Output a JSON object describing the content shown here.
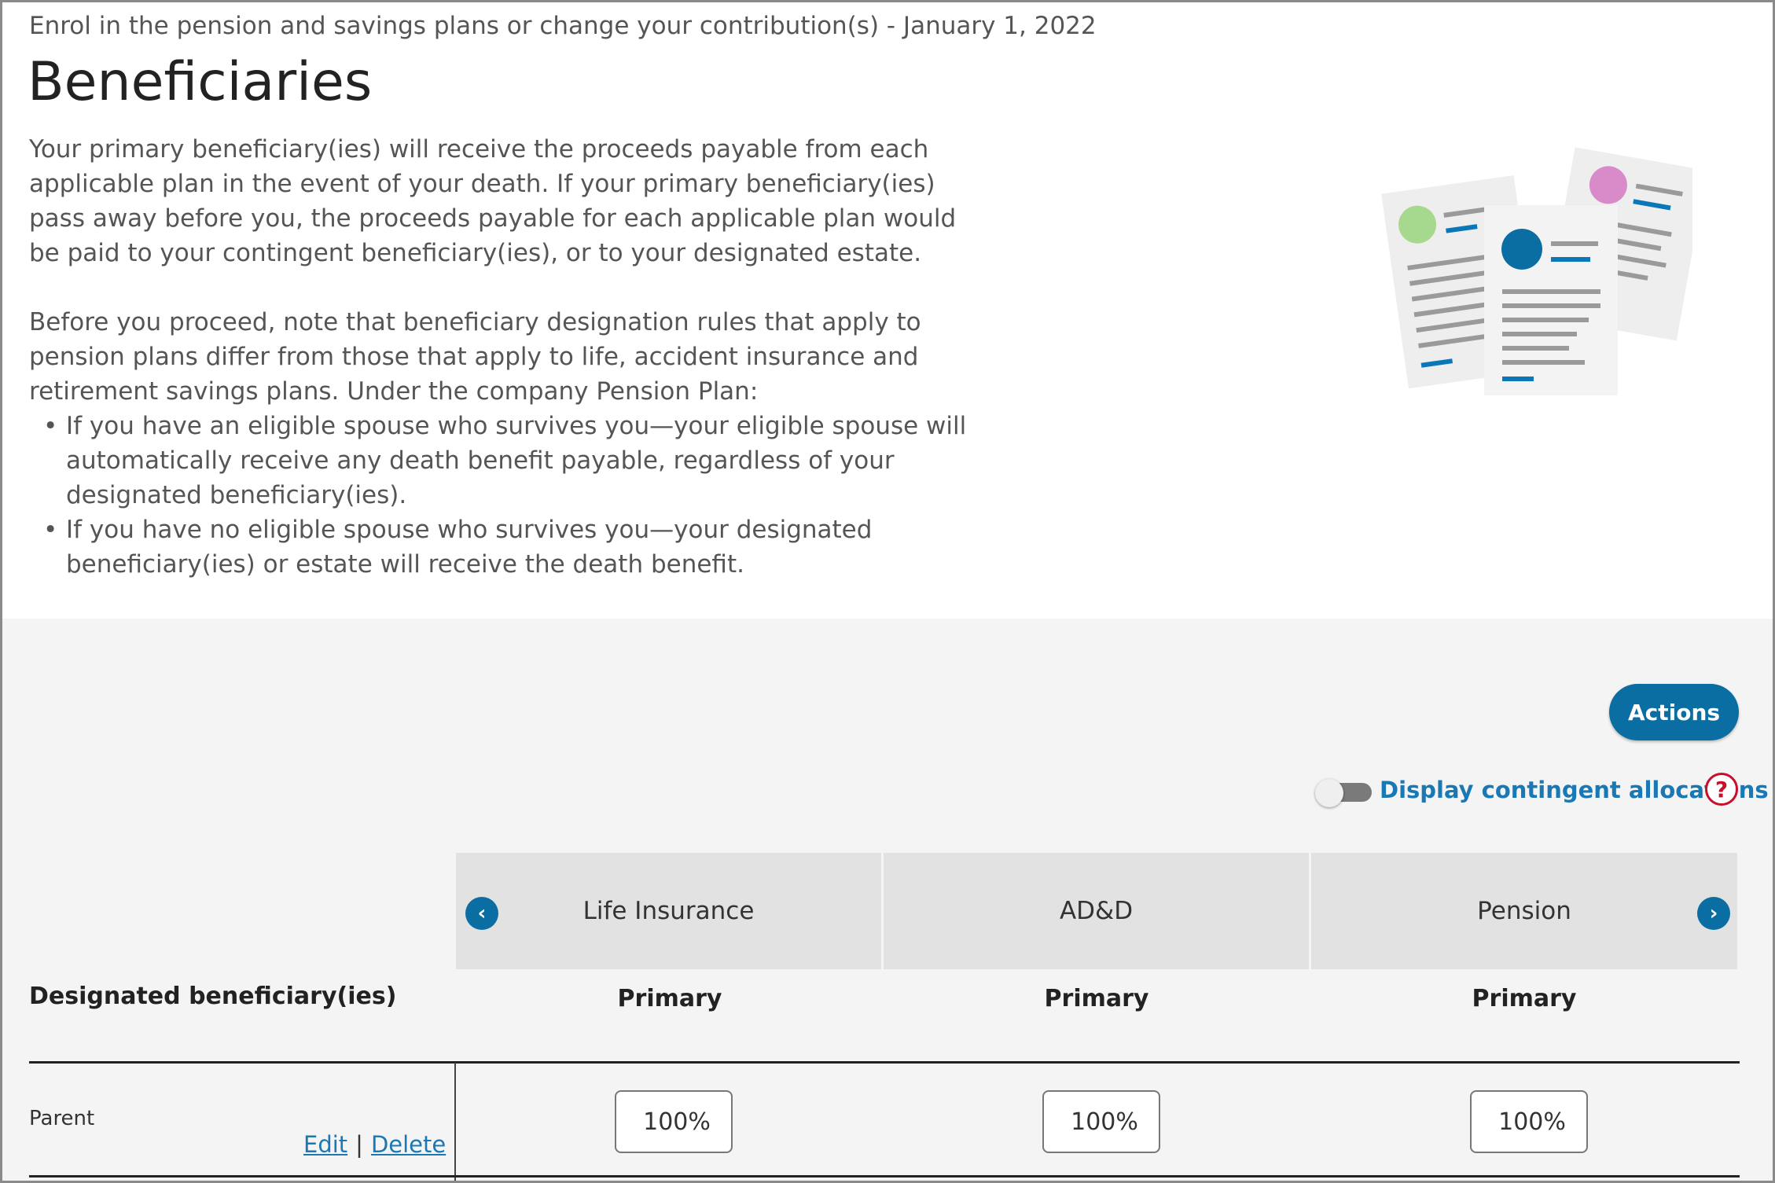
{
  "header": {
    "eyebrow": "Enrol in the pension and savings plans or change your contribution(s) - January 1, 2022",
    "title": "Beneficiaries"
  },
  "intro": {
    "paragraph1": "Your primary beneficiary(ies) will receive the proceeds payable from each applicable plan in the event of your death. If your primary beneficiary(ies) pass away before you, the proceeds payable for each applicable plan would be paid to your contingent beneficiary(ies), or to your designated estate.",
    "paragraph2": "Before you proceed, note that beneficiary designation rules that apply to pension plans differ from those that apply to life, accident insurance and retirement savings plans. Under the company Pension Plan:",
    "bullets": [
      "If you have an eligible spouse who survives you—your eligible spouse will automatically receive any death benefit payable, regardless of your designated beneficiary(ies).",
      "If you have no eligible spouse who survives you—your designated beneficiary(ies) or estate will receive the death benefit."
    ]
  },
  "toolbar": {
    "actions_label": "Actions",
    "toggle_label": "Display contingent allocations",
    "toggle_on": false,
    "help_symbol": "?"
  },
  "table": {
    "row_header": "Designated beneficiary(ies)",
    "prev_symbol": "‹",
    "next_symbol": "›",
    "plans": [
      {
        "name": "Life Insurance",
        "sub": "Primary"
      },
      {
        "name": "AD&D",
        "sub": "Primary"
      },
      {
        "name": "Pension",
        "sub": "Primary"
      }
    ],
    "rows": [
      {
        "name": "Parent",
        "edit_label": "Edit",
        "delete_label": "Delete",
        "separator": "|",
        "values": [
          "100%",
          "100%",
          "100%"
        ]
      }
    ]
  },
  "colors": {
    "accent": "#0a6ea3",
    "link": "#1a78b5",
    "help": "#c8102e",
    "panel_bg": "#f4f4f4",
    "header_bg": "#e2e2e2"
  }
}
